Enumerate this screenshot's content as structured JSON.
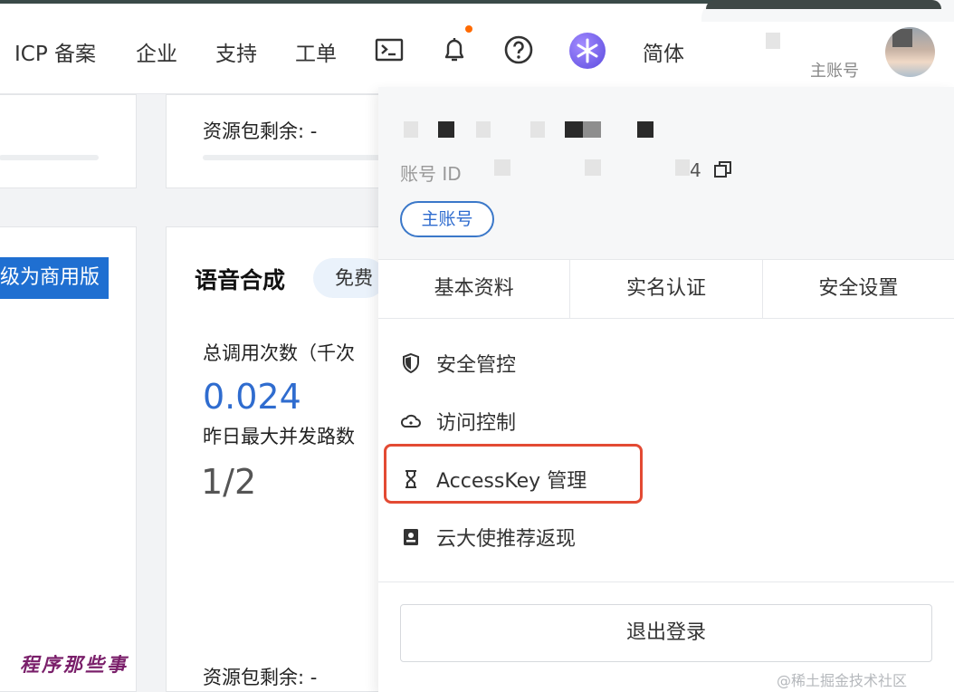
{
  "header": {
    "nav": [
      "ICP 备案",
      "企业",
      "支持",
      "工单"
    ],
    "icons": [
      "terminal-icon",
      "bell-icon",
      "help-icon",
      "brand-logo-icon"
    ],
    "language": "简体",
    "account_type": "主账号"
  },
  "cards": {
    "resource_remaining_top": "资源包剩余: -",
    "upgrade_button": "级为商用版",
    "section_title": "语音合成",
    "free_tag": "免费",
    "total_calls_label": "总调用次数（千次",
    "total_calls_value": "0.024",
    "max_concurrent_label": "昨日最大并发路数",
    "max_concurrent_value": "1/2",
    "resource_remaining_bottom": "资源包剩余: -"
  },
  "dropdown": {
    "account_id_label": "账号 ID",
    "account_id_suffix": "4",
    "account_tag": "主账号",
    "tabs": [
      "基本资料",
      "实名认证",
      "安全设置"
    ],
    "menu": [
      {
        "label": "安全管控",
        "icon": "shield-icon"
      },
      {
        "label": "访问控制",
        "icon": "cloud-icon"
      },
      {
        "label": "AccessKey 管理",
        "icon": "key-icon"
      },
      {
        "label": "云大使推荐返现",
        "icon": "id-card-icon"
      }
    ],
    "logout": "退出登录"
  },
  "watermarks": {
    "left": "程序那些事",
    "right": "@稀土掘金技术社区"
  },
  "colors": {
    "accent_blue": "#2f6ccf",
    "highlight_red": "#e34a33",
    "notification_orange": "#ff6a00"
  }
}
